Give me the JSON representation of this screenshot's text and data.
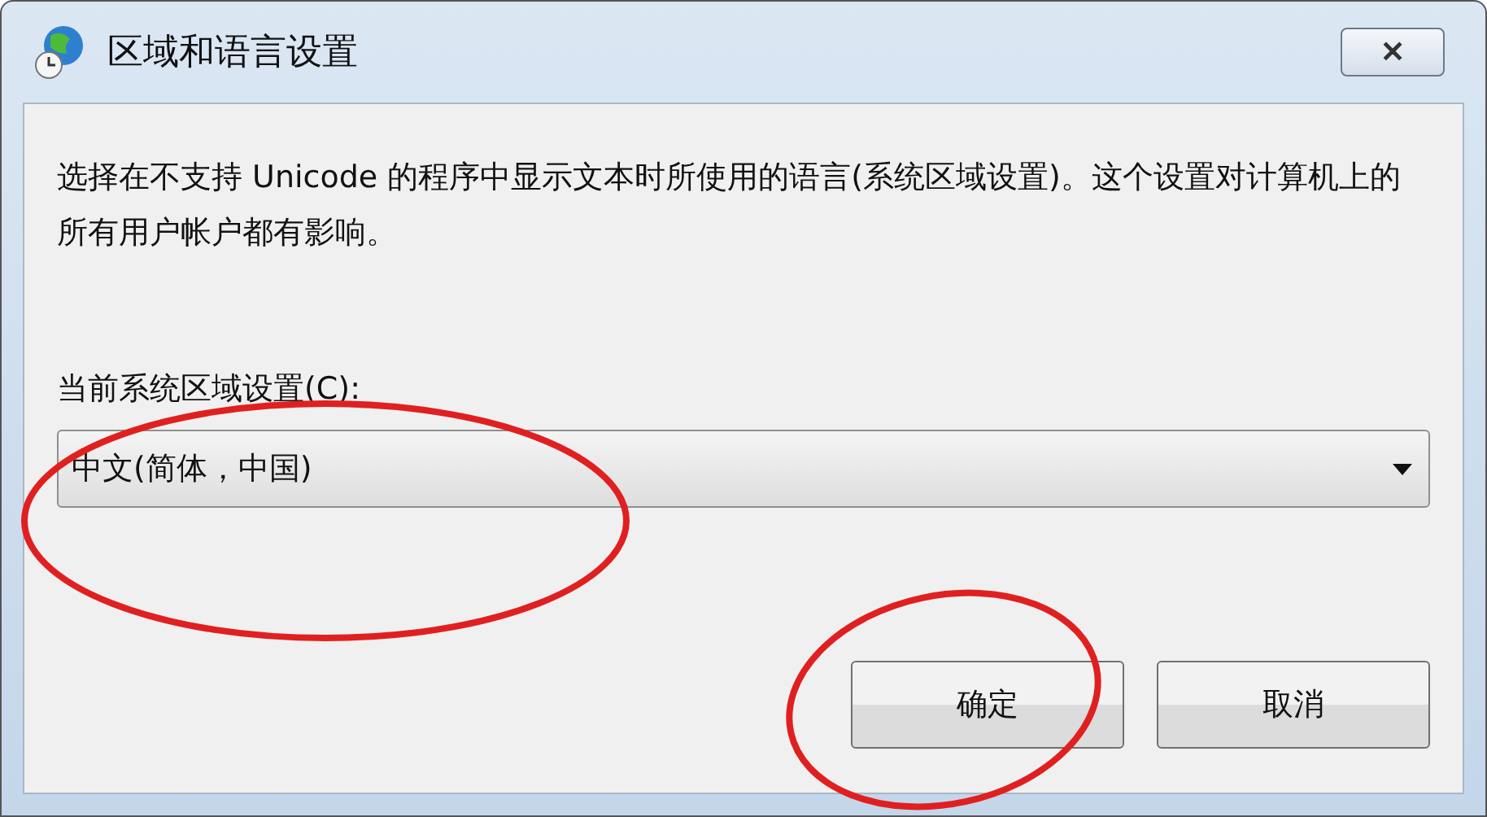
{
  "window": {
    "title": "区域和语言设置",
    "close": "✕"
  },
  "description": "选择在不支持 Unicode 的程序中显示文本时所使用的语言(系统区域设置)。这个设置对计算机上的所有用户帐户都有影响。",
  "locale_label": "当前系统区域设置(C):",
  "locale_dropdown": {
    "value": "中文(简体，中国)"
  },
  "buttons": [
    "确定",
    "取消"
  ]
}
